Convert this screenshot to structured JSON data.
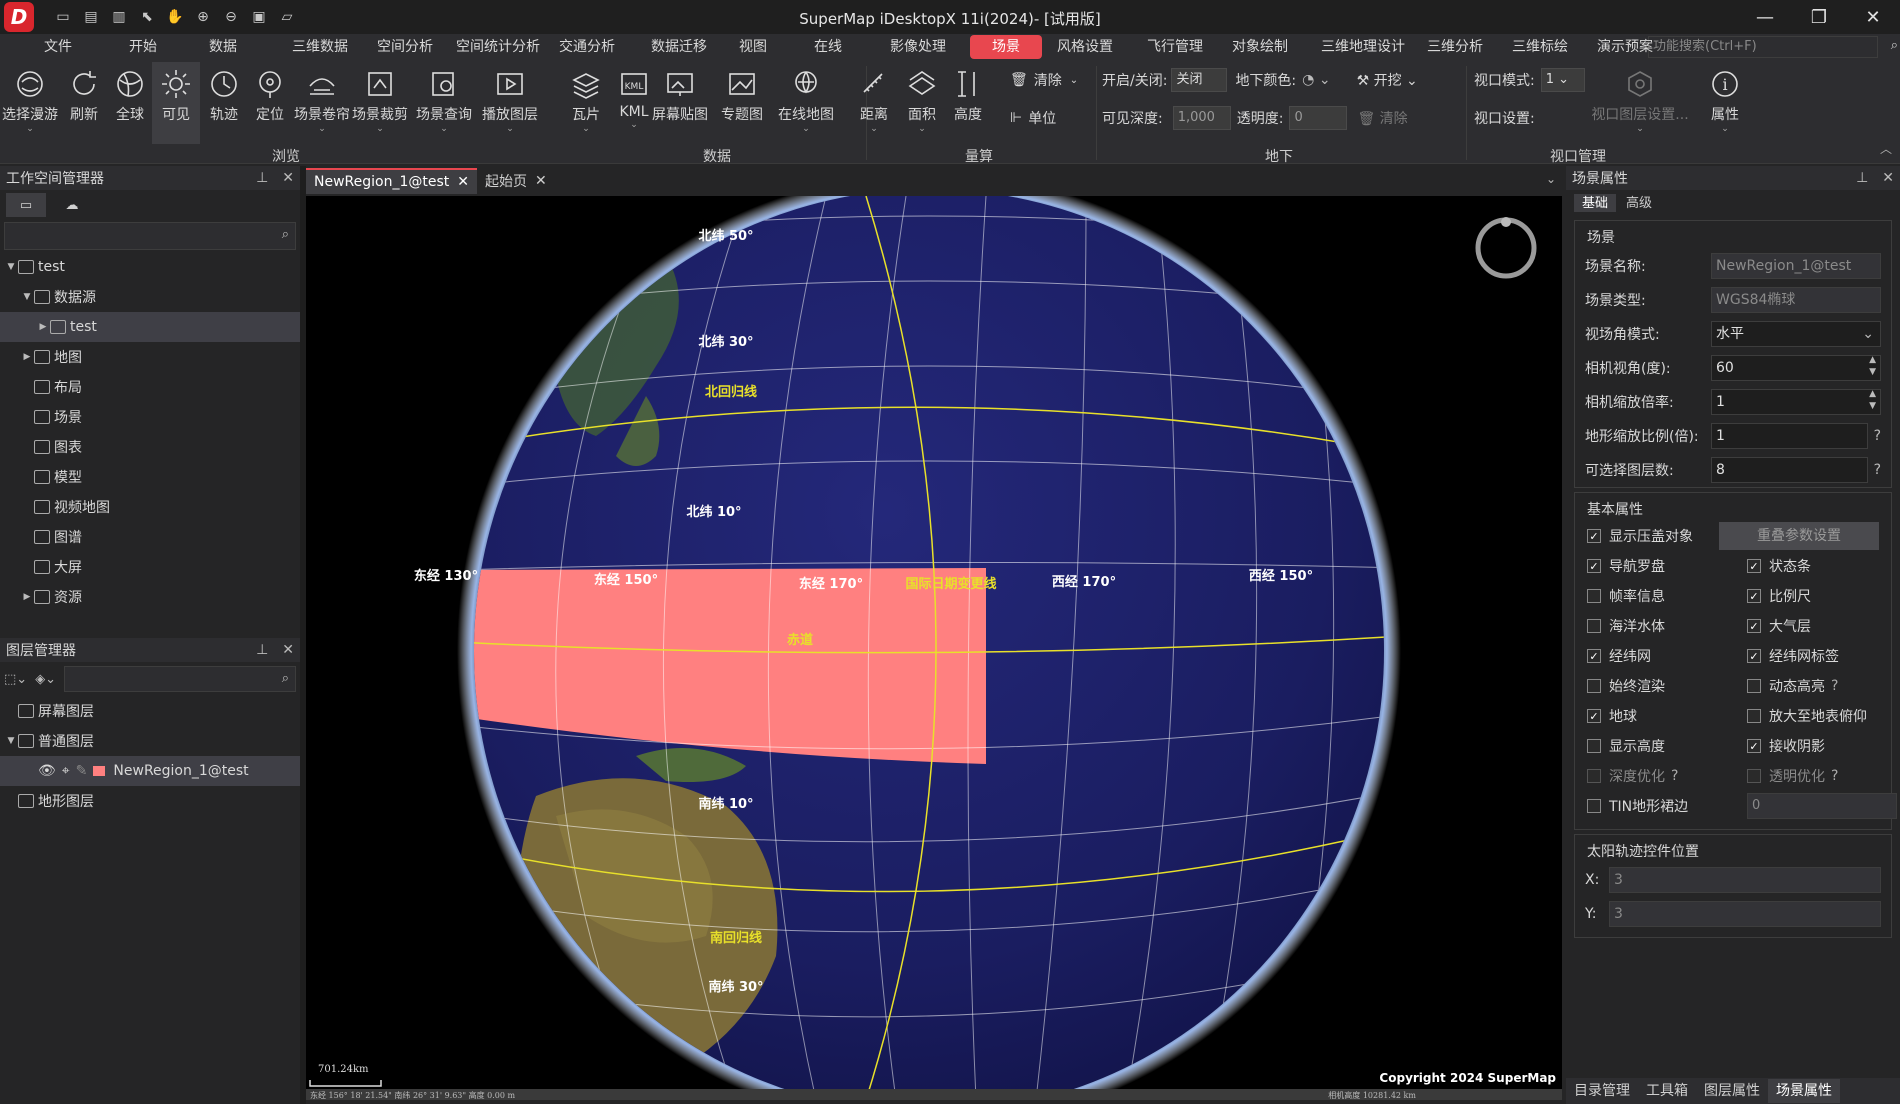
{
  "app": {
    "title": "SuperMap iDesktopX 11i(2024)- [试用版]",
    "logo": "D"
  },
  "menu": [
    "文件",
    "开始",
    "数据",
    "三维数据",
    "空间分析",
    "空间统计分析",
    "交通分析",
    "数据迁移",
    "视图",
    "在线",
    "影像处理",
    "场景",
    "风格设置",
    "飞行管理",
    "对象绘制",
    "三维地理设计",
    "三维分析",
    "三维标绘",
    "演示预案"
  ],
  "active_menu_index": 11,
  "search_placeholder": "功能搜索(Ctrl+F)",
  "ribbon": {
    "browse": [
      "选择漫游",
      "刷新",
      "全球",
      "可见",
      "轨迹",
      "定位",
      "场景卷帘",
      "场景裁剪",
      "场景查询",
      "播放图层"
    ],
    "data": [
      "瓦片",
      "KML",
      "屏幕贴图",
      "专题图",
      "在线地图"
    ],
    "measure": [
      "距离",
      "面积",
      "高度"
    ],
    "clear_label": "清除",
    "unit_label": "单位",
    "underground": {
      "toggle_label": "开启/关闭:",
      "toggle_value": "关闭",
      "color_label": "地下颜色:",
      "dig_label": "开挖",
      "depth_label": "可见深度:",
      "depth_value": "1,000",
      "transparency_label": "透明度:",
      "transparency_value": "0",
      "clear_label": "清除"
    },
    "viewport": {
      "mode_label": "视口模式:",
      "mode_value": "1",
      "settings_label": "视口设置:",
      "layers_label": "视口图层设置...",
      "props_label": "属性"
    },
    "groups": {
      "browse": "浏览",
      "data": "数据",
      "measure": "量算",
      "underground": "地下",
      "viewport": "视口管理"
    }
  },
  "workspace": {
    "title": "工作空间管理器",
    "tree": [
      {
        "label": "test",
        "level": 0,
        "arrow": "▼",
        "icon": "ws"
      },
      {
        "label": "数据源",
        "level": 1,
        "arrow": "▼",
        "icon": "ds"
      },
      {
        "label": "test",
        "level": 2,
        "arrow": "▶",
        "icon": "udbx",
        "selected": true
      },
      {
        "label": "地图",
        "level": 1,
        "arrow": "▶",
        "icon": "map"
      },
      {
        "label": "布局",
        "level": 1,
        "arrow": "",
        "icon": "layout"
      },
      {
        "label": "场景",
        "level": 1,
        "arrow": "",
        "icon": "scene"
      },
      {
        "label": "图表",
        "level": 1,
        "arrow": "",
        "icon": "chart"
      },
      {
        "label": "模型",
        "level": 1,
        "arrow": "",
        "icon": "model"
      },
      {
        "label": "视频地图",
        "level": 1,
        "arrow": "",
        "icon": "video"
      },
      {
        "label": "图谱",
        "level": 1,
        "arrow": "",
        "icon": "graph"
      },
      {
        "label": "大屏",
        "level": 1,
        "arrow": "",
        "icon": "screen"
      },
      {
        "label": "资源",
        "level": 1,
        "arrow": "▶",
        "icon": "folder"
      }
    ]
  },
  "layers": {
    "title": "图层管理器",
    "tree": [
      {
        "label": "屏幕图层",
        "level": 0,
        "arrow": ""
      },
      {
        "label": "普通图层",
        "level": 0,
        "arrow": "▼"
      },
      {
        "label": "NewRegion_1@test",
        "level": 1,
        "arrow": "",
        "selected": true
      },
      {
        "label": "地形图层",
        "level": 0,
        "arrow": ""
      }
    ]
  },
  "tabs": [
    {
      "label": "NewRegion_1@test",
      "active": true
    },
    {
      "label": "起始页",
      "active": false
    }
  ],
  "globe_labels": {
    "n50": "北纬 50°",
    "n30": "北纬 30°",
    "tropic_n": "北回归线",
    "n10": "北纬 10°",
    "e130": "东经 130°",
    "e150": "东经 150°",
    "e170": "东经 170°",
    "dateline": "国际日期变更线",
    "w170": "西经 170°",
    "w150": "西经 150°",
    "equator": "赤道",
    "s10": "南纬 10°",
    "tropic_s": "南回归线",
    "s30": "南纬 30°"
  },
  "scale_bar": "701.24km",
  "status_line": "东经 156° 18' 21.54\"  南纬 26° 31' 9.63\"  高度 0.00 m",
  "camera_height": "相机高度 10281.42 km",
  "copyright": "Copyright 2024 SuperMap",
  "scene_props": {
    "title": "场景属性",
    "tabs": [
      "基础",
      "高级"
    ],
    "group1": "场景",
    "rows": [
      {
        "label": "场景名称:",
        "value": "NewRegion_1@test",
        "disabled": true
      },
      {
        "label": "场景类型:",
        "value": "WGS84椭球",
        "disabled": true
      },
      {
        "label": "视场角模式:",
        "value": "水平",
        "select": true
      },
      {
        "label": "相机视角(度):",
        "value": "60",
        "spin": true
      },
      {
        "label": "相机缩放倍率:",
        "value": "1",
        "spin": true
      },
      {
        "label": "地形缩放比例(倍):",
        "value": "1",
        "help": true
      },
      {
        "label": "可选择图层数:",
        "value": "8",
        "help": true
      }
    ],
    "group2": "基本属性",
    "reset_button": "重叠参数设置",
    "checks": [
      {
        "label": "显示压盖对象",
        "checked": true
      },
      {
        "label": "导航罗盘",
        "checked": true
      },
      {
        "label": "状态条",
        "checked": true
      },
      {
        "label": "帧率信息",
        "checked": false
      },
      {
        "label": "比例尺",
        "checked": true
      },
      {
        "label": "海洋水体",
        "checked": false
      },
      {
        "label": "大气层",
        "checked": true
      },
      {
        "label": "经纬网",
        "checked": true
      },
      {
        "label": "经纬网标签",
        "checked": true
      },
      {
        "label": "始终渲染",
        "checked": false
      },
      {
        "label": "动态高亮",
        "checked": false,
        "help": true
      },
      {
        "label": "地球",
        "checked": true
      },
      {
        "label": "放大至地表俯仰",
        "checked": false
      },
      {
        "label": "显示高度",
        "checked": false
      },
      {
        "label": "接收阴影",
        "checked": true
      },
      {
        "label": "深度优化",
        "checked": false,
        "help": true,
        "disabled": true
      },
      {
        "label": "透明优化",
        "checked": false,
        "help": true,
        "disabled": true
      },
      {
        "label": "TIN地形裙边",
        "checked": false
      }
    ],
    "tin_value": "0",
    "group3": "太阳轨迹控件位置",
    "x_label": "X:",
    "x_value": "3",
    "y_label": "Y:",
    "y_value": "3"
  },
  "bottom_tabs": [
    "目录管理",
    "工具箱",
    "图层属性",
    "场景属性"
  ],
  "colors": {
    "accent": "#e8474f",
    "region": "#ff8080",
    "grid": "#ffffff",
    "yellow": "#e8e02a"
  }
}
